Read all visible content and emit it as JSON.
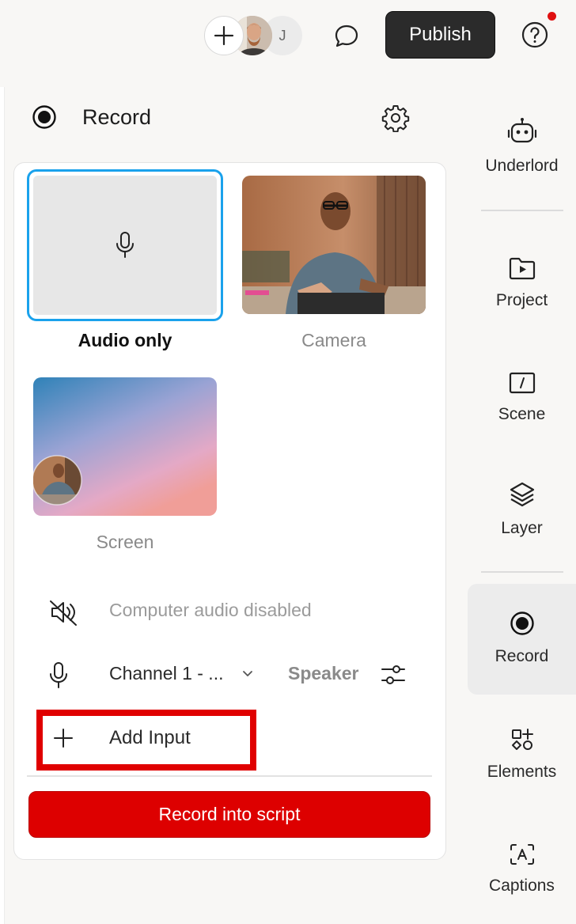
{
  "topbar": {
    "add_icon": "plus-icon",
    "avatar_initial": "J",
    "comment_icon": "comment-icon",
    "publish_label": "Publish",
    "help_icon": "help-icon",
    "notification_color": "#e01010"
  },
  "panel": {
    "title": "Record",
    "title_icon": "record-icon",
    "settings_icon": "gear-icon",
    "sources": [
      {
        "label": "Audio only",
        "selected": true,
        "icon": "microphone-icon"
      },
      {
        "label": "Camera",
        "selected": false
      },
      {
        "label": "Screen",
        "selected": false
      }
    ],
    "computer_audio": {
      "icon": "speaker-muted-icon",
      "text": "Computer audio disabled"
    },
    "mic_input": {
      "icon": "microphone-icon",
      "channel": "Channel 1 - ...",
      "device": "Speaker",
      "tune_icon": "sliders-icon"
    },
    "add_input_label": "Add Input",
    "record_button_label": "Record into script"
  },
  "rail": [
    {
      "label": "Underlord",
      "icon": "robot-icon",
      "active": false
    },
    {
      "label": "Project",
      "icon": "project-icon",
      "active": false
    },
    {
      "label": "Scene",
      "icon": "scene-icon",
      "active": false
    },
    {
      "label": "Layer",
      "icon": "layers-icon",
      "active": false
    },
    {
      "label": "Record",
      "icon": "record-icon",
      "active": true
    },
    {
      "label": "Elements",
      "icon": "elements-icon",
      "active": false
    },
    {
      "label": "Captions",
      "icon": "captions-icon",
      "active": false
    }
  ],
  "colors": {
    "accent_red": "#dd0000",
    "selection_blue": "#1aa2ec",
    "highlight_red": "#e00000"
  }
}
